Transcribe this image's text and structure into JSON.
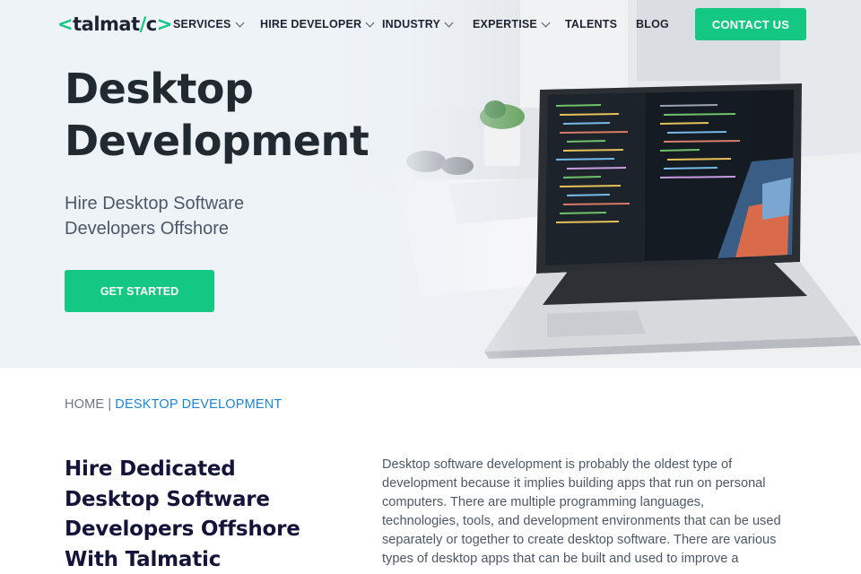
{
  "brand": {
    "logo_left": "<",
    "logo_text": "talmat",
    "logo_slash": "/",
    "logo_c": "c",
    "logo_right": ">"
  },
  "nav": {
    "items": [
      {
        "label": "SERVICES",
        "has_dropdown": true
      },
      {
        "label": "HIRE DEVELOPER",
        "has_dropdown": true
      },
      {
        "label": "INDUSTRY",
        "has_dropdown": true
      },
      {
        "label": "EXPERTISE",
        "has_dropdown": true
      },
      {
        "label": "TALENTS",
        "has_dropdown": false
      },
      {
        "label": "BLOG",
        "has_dropdown": false
      }
    ],
    "contact_label": "CONTACT US"
  },
  "hero": {
    "title_line1": "Desktop",
    "title_line2": "Development",
    "subtitle_line1": "Hire Desktop Software",
    "subtitle_line2": "Developers Offshore",
    "cta_label": "GET STARTED",
    "image": "laptop-on-desk-with-code"
  },
  "breadcrumb": {
    "home": "HOME",
    "separator": "|",
    "current": "DESKTOP DEVELOPMENT"
  },
  "section": {
    "heading_lines": [
      "Hire Dedicated",
      "Desktop Software",
      "Developers Offshore",
      "With Talmatic"
    ],
    "body_lines": [
      "Desktop software development is probably the oldest type of",
      "development because it implies building apps that run on personal",
      "computers. There are multiple programming languages,",
      "technologies, tools, and development environments that can be used",
      "separately or together to create desktop software. There are various",
      "types of desktop apps that can be built and used to improve a"
    ]
  },
  "colors": {
    "accent": "#14c883",
    "link": "#1a86d8",
    "heading": "#14143b",
    "hero_bg": "#eef3f8"
  }
}
